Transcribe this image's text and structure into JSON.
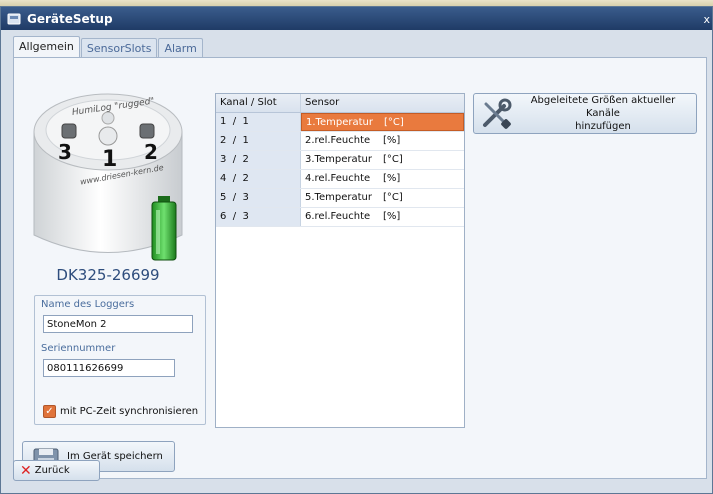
{
  "window": {
    "title": "GeräteSetup",
    "close": "x"
  },
  "tabs": [
    "Allgemein",
    "SensorSlots",
    "Alarm"
  ],
  "device": {
    "model": "DK325-26699",
    "brand_text": "HumiLog \"rugged\"",
    "site_text": "www.driesen-kern.de",
    "ports": [
      "3",
      "1",
      "2"
    ]
  },
  "logger": {
    "name_label": "Name des Loggers",
    "name_value": "StoneMon 2",
    "serial_label": "Seriennummer",
    "serial_value": "080111626699",
    "sync_label": "mit PC-Zeit synchronisieren",
    "sync_checked": true
  },
  "sensor_table": {
    "headers": [
      "Kanal / Slot",
      "Sensor"
    ],
    "rows": [
      {
        "kanal_slot": "1  /  1",
        "sensor": "1.Temperatur",
        "unit": "[°C]",
        "selected": true
      },
      {
        "kanal_slot": "2  /  1",
        "sensor": "2.rel.Feuchte",
        "unit": "[%]",
        "selected": false
      },
      {
        "kanal_slot": "3  /  2",
        "sensor": "3.Temperatur",
        "unit": "[°C]",
        "selected": false
      },
      {
        "kanal_slot": "4  /  2",
        "sensor": "4.rel.Feuchte",
        "unit": "[%]",
        "selected": false
      },
      {
        "kanal_slot": "5  /  3",
        "sensor": "5.Temperatur",
        "unit": "[°C]",
        "selected": false
      },
      {
        "kanal_slot": "6  /  3",
        "sensor": "6.rel.Feuchte",
        "unit": "[%]",
        "selected": false
      }
    ]
  },
  "buttons": {
    "derived_line1": "Abgeleitete Größen aktueller Kanäle",
    "derived_line2": "hinzufügen",
    "save": "Im Gerät speichern",
    "back": "Zurück"
  },
  "colors": {
    "accent": "#e97a3e",
    "titlebar": "#1f3b66",
    "link_blue": "#4a6d9d"
  },
  "icons": {
    "derived": "tools-icon",
    "save": "floppy-disk-icon",
    "back": "red-x-icon",
    "battery": "battery-full-icon"
  }
}
